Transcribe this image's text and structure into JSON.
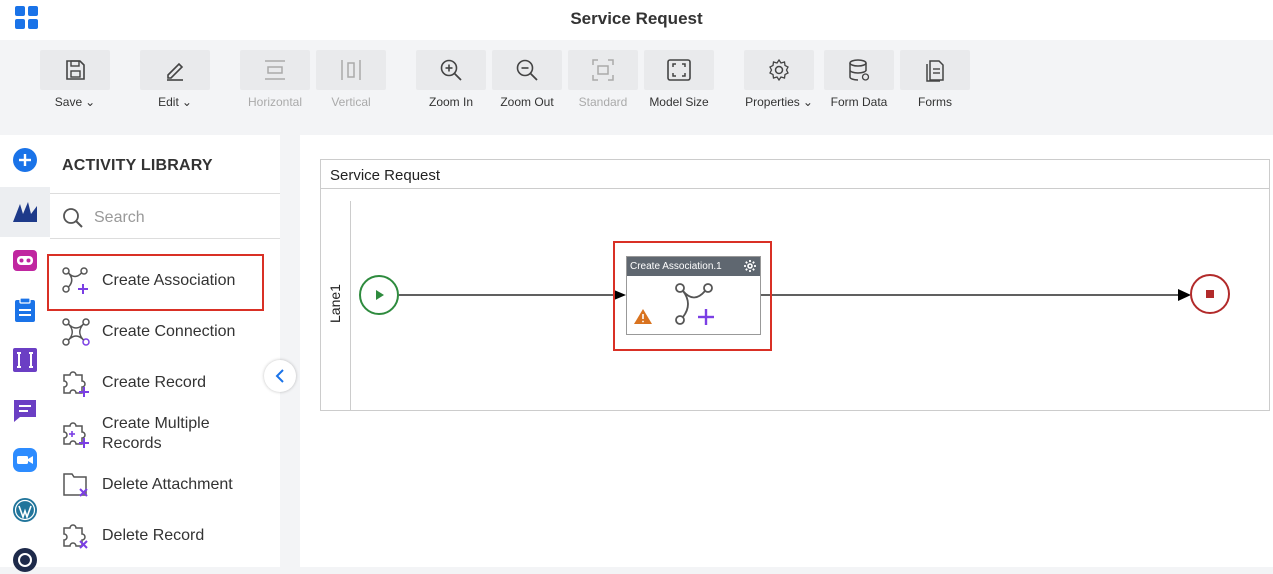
{
  "header": {
    "title": "Service Request"
  },
  "toolbar": {
    "save": "Save",
    "edit": "Edit",
    "horizontal": "Horizontal",
    "vertical": "Vertical",
    "zoom_in": "Zoom In",
    "zoom_out": "Zoom Out",
    "standard": "Standard",
    "model_size": "Model Size",
    "properties": "Properties",
    "form_data": "Form Data",
    "forms": "Forms"
  },
  "library": {
    "title": "ACTIVITY LIBRARY",
    "search_placeholder": "Search",
    "items": [
      {
        "label": "Create Association",
        "icon": "create-association-icon"
      },
      {
        "label": "Create Connection",
        "icon": "create-connection-icon"
      },
      {
        "label": "Create Record",
        "icon": "create-record-icon"
      },
      {
        "label": "Create Multiple Records",
        "icon": "create-multiple-records-icon"
      },
      {
        "label": "Delete Attachment",
        "icon": "delete-attachment-icon"
      },
      {
        "label": "Delete Record",
        "icon": "delete-record-icon"
      }
    ]
  },
  "canvas": {
    "pool_title": "Service Request",
    "lane": "Lane1",
    "task_title": "Create Association.1"
  },
  "colors": {
    "accent_blue": "#1a73e8",
    "highlight_red": "#d93025",
    "start_green": "#2e8b3e",
    "end_red": "#b22a2a",
    "purple": "#7b3fe4"
  }
}
